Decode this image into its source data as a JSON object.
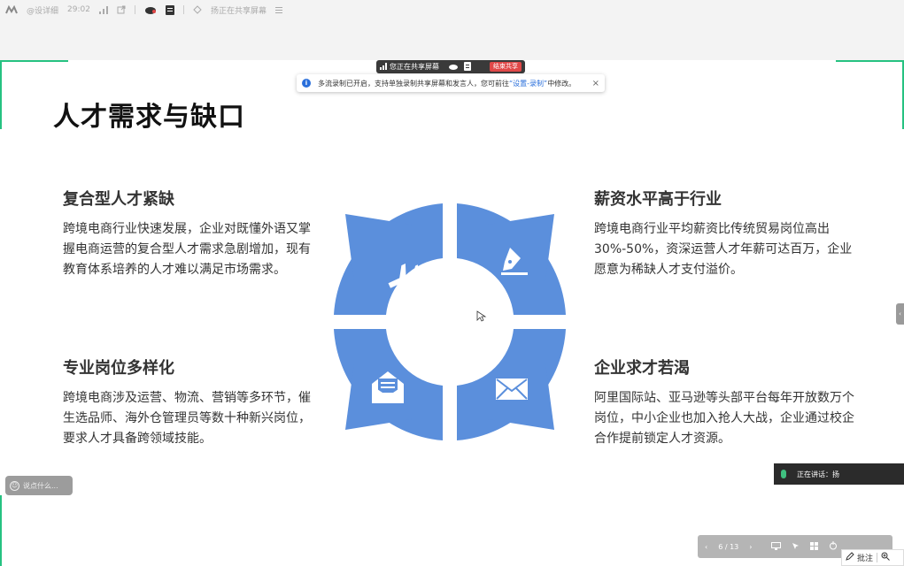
{
  "topbar": {
    "user": "@设详细",
    "time": "29:02",
    "status": "扬正在共享屏幕"
  },
  "sharebar": {
    "label": "您正在共享屏幕",
    "stop": "结束共享"
  },
  "notice": {
    "text": "多流录制已开启，支持单独录制共享屏幕和发言人，您可前往",
    "link": "“设置-录制”",
    "suffix": "中修改。",
    "close": "×"
  },
  "slide": {
    "title": "人才需求与缺口",
    "blocks": [
      {
        "title": "复合型人才紧缺",
        "body": "跨境电商行业快速发展，企业对既懂外语又掌握电商运营的复合型人才需求急剧增加，现有教育体系培养的人才难以满足市场需求。"
      },
      {
        "title": "薪资水平高于行业",
        "body": "跨境电商行业平均薪资比传统贸易岗位高出30%-50%，资深运营人才年薪可达百万，企业愿意为稀缺人才支付溢价。"
      },
      {
        "title": "专业岗位多样化",
        "body": "跨境电商涉及运营、物流、营销等多环节，催生选品师、海外仓管理员等数十种新兴岗位，要求人才具备跨领域技能。"
      },
      {
        "title": "企业求才若渴",
        "body": "阿里国际站、亚马逊等头部平台每年开放数万个岗位，中小企业也加入抢人大战，企业通过校企合作提前锁定人才资源。"
      }
    ],
    "wheel_color": "#5b8fdc"
  },
  "comment": {
    "placeholder": "说点什么..."
  },
  "speaking": {
    "label": "正在讲话：扬"
  },
  "controls": {
    "page": "6 / 13"
  },
  "annotate": {
    "label": "批注"
  }
}
